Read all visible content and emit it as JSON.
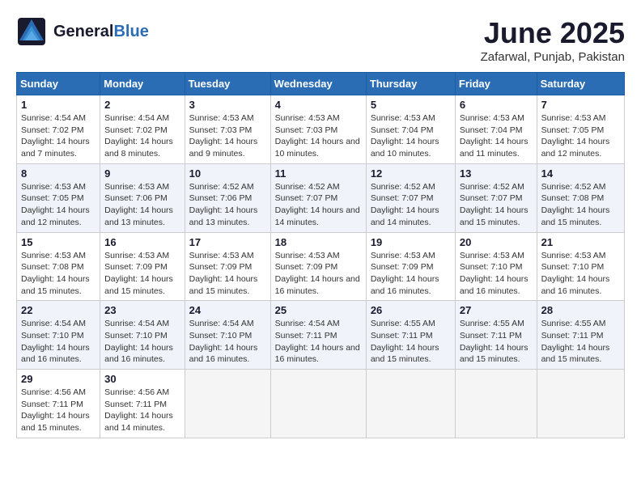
{
  "header": {
    "logo_general": "General",
    "logo_blue": "Blue",
    "month_title": "June 2025",
    "location": "Zafarwal, Punjab, Pakistan"
  },
  "calendar": {
    "days_of_week": [
      "Sunday",
      "Monday",
      "Tuesday",
      "Wednesday",
      "Thursday",
      "Friday",
      "Saturday"
    ],
    "weeks": [
      [
        {
          "day": "1",
          "sunrise": "4:54 AM",
          "sunset": "7:02 PM",
          "daylight": "14 hours and 7 minutes."
        },
        {
          "day": "2",
          "sunrise": "4:54 AM",
          "sunset": "7:02 PM",
          "daylight": "14 hours and 8 minutes."
        },
        {
          "day": "3",
          "sunrise": "4:53 AM",
          "sunset": "7:03 PM",
          "daylight": "14 hours and 9 minutes."
        },
        {
          "day": "4",
          "sunrise": "4:53 AM",
          "sunset": "7:03 PM",
          "daylight": "14 hours and 10 minutes."
        },
        {
          "day": "5",
          "sunrise": "4:53 AM",
          "sunset": "7:04 PM",
          "daylight": "14 hours and 10 minutes."
        },
        {
          "day": "6",
          "sunrise": "4:53 AM",
          "sunset": "7:04 PM",
          "daylight": "14 hours and 11 minutes."
        },
        {
          "day": "7",
          "sunrise": "4:53 AM",
          "sunset": "7:05 PM",
          "daylight": "14 hours and 12 minutes."
        }
      ],
      [
        {
          "day": "8",
          "sunrise": "4:53 AM",
          "sunset": "7:05 PM",
          "daylight": "14 hours and 12 minutes."
        },
        {
          "day": "9",
          "sunrise": "4:53 AM",
          "sunset": "7:06 PM",
          "daylight": "14 hours and 13 minutes."
        },
        {
          "day": "10",
          "sunrise": "4:52 AM",
          "sunset": "7:06 PM",
          "daylight": "14 hours and 13 minutes."
        },
        {
          "day": "11",
          "sunrise": "4:52 AM",
          "sunset": "7:07 PM",
          "daylight": "14 hours and 14 minutes."
        },
        {
          "day": "12",
          "sunrise": "4:52 AM",
          "sunset": "7:07 PM",
          "daylight": "14 hours and 14 minutes."
        },
        {
          "day": "13",
          "sunrise": "4:52 AM",
          "sunset": "7:07 PM",
          "daylight": "14 hours and 15 minutes."
        },
        {
          "day": "14",
          "sunrise": "4:52 AM",
          "sunset": "7:08 PM",
          "daylight": "14 hours and 15 minutes."
        }
      ],
      [
        {
          "day": "15",
          "sunrise": "4:53 AM",
          "sunset": "7:08 PM",
          "daylight": "14 hours and 15 minutes."
        },
        {
          "day": "16",
          "sunrise": "4:53 AM",
          "sunset": "7:09 PM",
          "daylight": "14 hours and 15 minutes."
        },
        {
          "day": "17",
          "sunrise": "4:53 AM",
          "sunset": "7:09 PM",
          "daylight": "14 hours and 15 minutes."
        },
        {
          "day": "18",
          "sunrise": "4:53 AM",
          "sunset": "7:09 PM",
          "daylight": "14 hours and 16 minutes."
        },
        {
          "day": "19",
          "sunrise": "4:53 AM",
          "sunset": "7:09 PM",
          "daylight": "14 hours and 16 minutes."
        },
        {
          "day": "20",
          "sunrise": "4:53 AM",
          "sunset": "7:10 PM",
          "daylight": "14 hours and 16 minutes."
        },
        {
          "day": "21",
          "sunrise": "4:53 AM",
          "sunset": "7:10 PM",
          "daylight": "14 hours and 16 minutes."
        }
      ],
      [
        {
          "day": "22",
          "sunrise": "4:54 AM",
          "sunset": "7:10 PM",
          "daylight": "14 hours and 16 minutes."
        },
        {
          "day": "23",
          "sunrise": "4:54 AM",
          "sunset": "7:10 PM",
          "daylight": "14 hours and 16 minutes."
        },
        {
          "day": "24",
          "sunrise": "4:54 AM",
          "sunset": "7:10 PM",
          "daylight": "14 hours and 16 minutes."
        },
        {
          "day": "25",
          "sunrise": "4:54 AM",
          "sunset": "7:11 PM",
          "daylight": "14 hours and 16 minutes."
        },
        {
          "day": "26",
          "sunrise": "4:55 AM",
          "sunset": "7:11 PM",
          "daylight": "14 hours and 15 minutes."
        },
        {
          "day": "27",
          "sunrise": "4:55 AM",
          "sunset": "7:11 PM",
          "daylight": "14 hours and 15 minutes."
        },
        {
          "day": "28",
          "sunrise": "4:55 AM",
          "sunset": "7:11 PM",
          "daylight": "14 hours and 15 minutes."
        }
      ],
      [
        {
          "day": "29",
          "sunrise": "4:56 AM",
          "sunset": "7:11 PM",
          "daylight": "14 hours and 15 minutes."
        },
        {
          "day": "30",
          "sunrise": "4:56 AM",
          "sunset": "7:11 PM",
          "daylight": "14 hours and 14 minutes."
        },
        null,
        null,
        null,
        null,
        null
      ]
    ]
  }
}
